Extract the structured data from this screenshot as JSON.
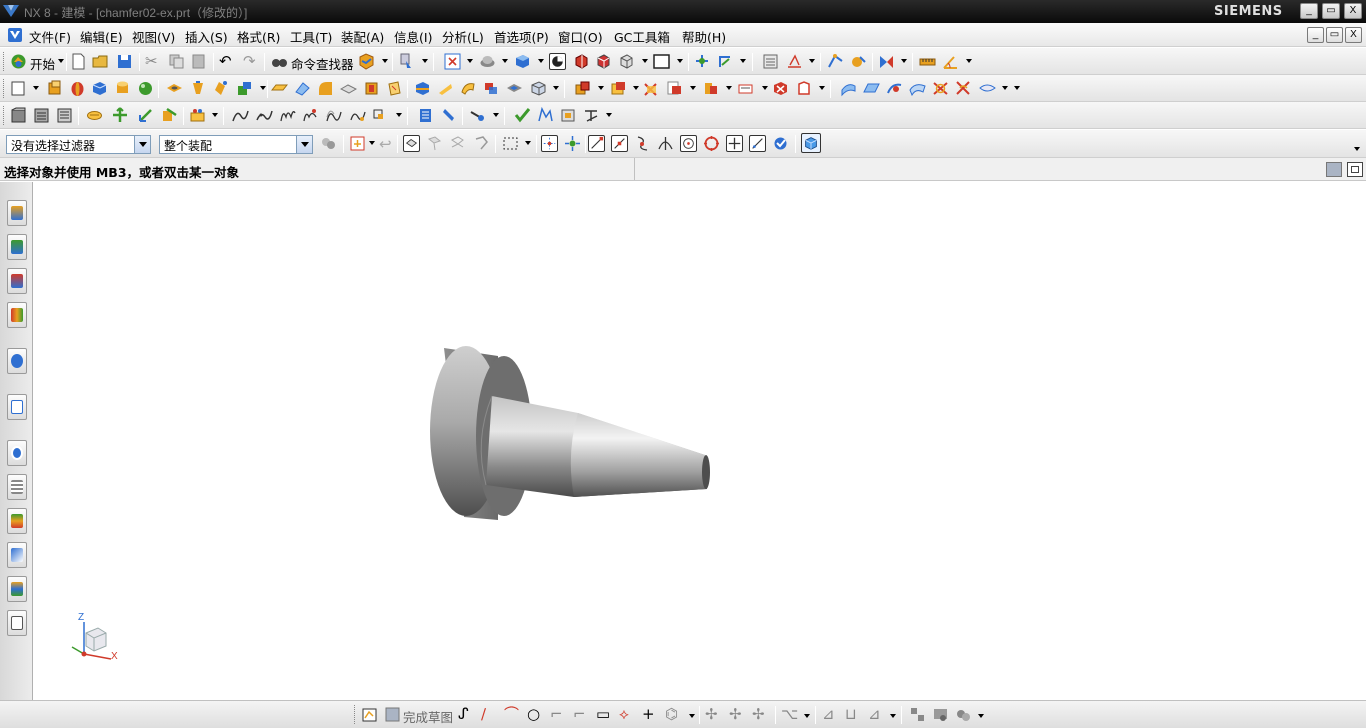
{
  "window": {
    "title": "NX 8 - 建模 - [chamfer02-ex.prt（修改的）]",
    "brand": "SIEMENS",
    "controls": [
      "_",
      "▭",
      "X"
    ]
  },
  "menubar": {
    "items": [
      "文件(F)",
      "编辑(E)",
      "视图(V)",
      "插入(S)",
      "格式(R)",
      "工具(T)",
      "装配(A)",
      "信息(I)",
      "分析(L)",
      "首选项(P)",
      "窗口(O)",
      "GC工具箱",
      "帮助(H)"
    ],
    "mdi_controls": [
      "_",
      "▭",
      "X"
    ]
  },
  "toolbar1": {
    "start_label": "开始",
    "command_finder_label": "命令查找器"
  },
  "selection_bar": {
    "filter_value": "没有选择过滤器",
    "scope_value": "整个装配"
  },
  "status": {
    "prompt": "选择对象并使用 MB3，或者双击某一对象"
  },
  "viewport": {
    "triad": {
      "z_label": "Z",
      "x_label": "X"
    }
  },
  "sketch_toolbar": {
    "finish_label": "完成草图"
  },
  "icons": {
    "resource_bar": [
      "assembly-navigator-icon",
      "constraint-navigator-icon",
      "part-navigator-icon",
      "reuse-library-icon",
      "web-browser-icon",
      "history-icon",
      "process-studio-icon",
      "roles-icon",
      "system-materials-icon",
      "manufacturing-wizard-icon",
      "palette-icon",
      "drafting-icon"
    ],
    "colors": {
      "accent_blue": "#2f6fd1",
      "orange": "#e8a020",
      "green": "#3c9a2c",
      "red": "#d03a2a"
    }
  }
}
